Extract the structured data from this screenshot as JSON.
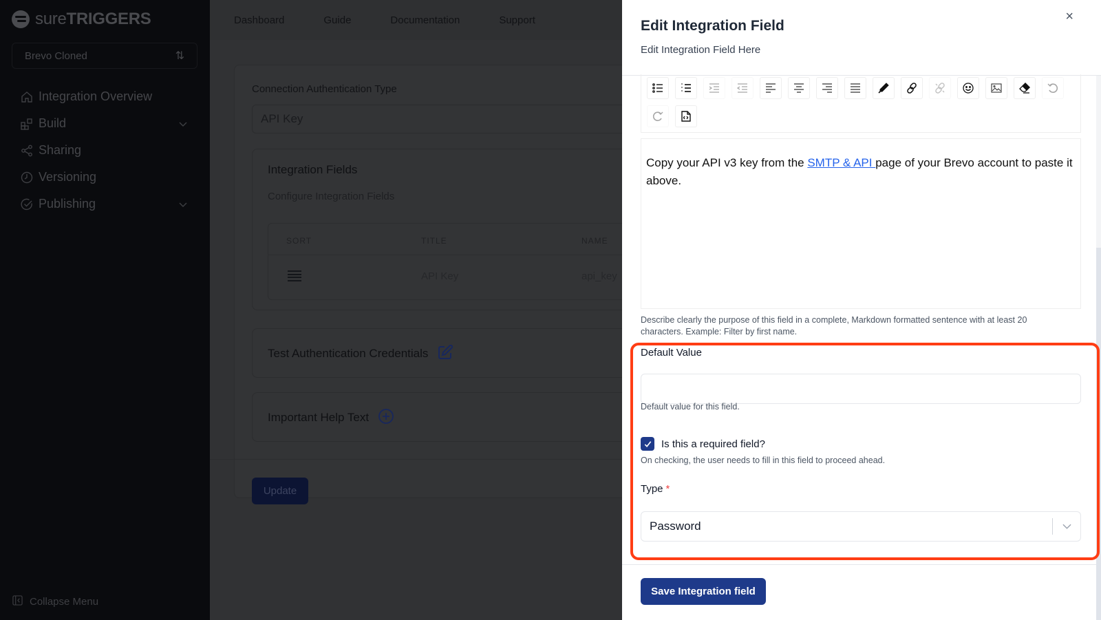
{
  "sidebar": {
    "logo": {
      "light": "sure",
      "bold": "TRIGGERS"
    },
    "project": "Brevo Cloned",
    "items": [
      {
        "label": "Integration Overview",
        "icon": "home-icon",
        "has_chevron": false
      },
      {
        "label": "Build",
        "icon": "blocks-icon",
        "has_chevron": true
      },
      {
        "label": "Sharing",
        "icon": "share-icon",
        "has_chevron": false
      },
      {
        "label": "Versioning",
        "icon": "clock-icon",
        "has_chevron": false
      },
      {
        "label": "Publishing",
        "icon": "check-circle-icon",
        "has_chevron": true
      }
    ],
    "collapse_label": "Collapse Menu"
  },
  "topnav": {
    "items": [
      "Dashboard",
      "Guide",
      "Documentation",
      "Support"
    ]
  },
  "main": {
    "auth_type_label": "Connection Authentication Type",
    "auth_type_value": "API Key",
    "fields_card": {
      "title": "Integration Fields",
      "description": "Configure Integration Fields",
      "columns": [
        "SORT",
        "TITLE",
        "NAME"
      ],
      "rows": [
        {
          "title": "API Key",
          "name": "api_key"
        }
      ]
    },
    "test_auth_title": "Test Authentication Credentials",
    "help_text_title": "Important Help Text",
    "update_label": "Update"
  },
  "drawer": {
    "title": "Edit Integration Field",
    "subtitle": "Edit Integration Field Here",
    "close_icon": "×",
    "toolbar": {
      "row1": [
        {
          "name": "bullet-list",
          "disabled": false
        },
        {
          "name": "numbered-list",
          "disabled": false
        },
        {
          "name": "indent",
          "disabled": true
        },
        {
          "name": "outdent",
          "disabled": true
        },
        {
          "name": "align-left",
          "disabled": false
        },
        {
          "name": "align-center",
          "disabled": false
        },
        {
          "name": "align-right",
          "disabled": false
        },
        {
          "name": "align-justify",
          "disabled": false
        },
        {
          "name": "text-color",
          "disabled": false
        },
        {
          "name": "link",
          "disabled": false
        },
        {
          "name": "unlink",
          "disabled": true
        },
        {
          "name": "emoji",
          "disabled": false
        },
        {
          "name": "image",
          "disabled": false
        },
        {
          "name": "remove-format",
          "disabled": false
        }
      ],
      "row2": [
        {
          "name": "undo",
          "disabled": true
        },
        {
          "name": "redo",
          "disabled": true
        },
        {
          "name": "source-code",
          "disabled": false
        }
      ]
    },
    "editor_content": {
      "before_link": "Copy your API v3 key from the ",
      "link_text": "SMTP & API ",
      "after_link": "page of your Brevo account to paste it above."
    },
    "editor_help": "Describe clearly the purpose of this field in a complete, Markdown formatted sentence with at least 20 characters. Example: Filter by first name.",
    "default_value": {
      "label": "Default Value",
      "value": "",
      "help": "Default value for this field."
    },
    "required": {
      "label": "Is this a required field?",
      "checked": true,
      "help": "On checking, the user needs to fill in this field to proceed ahead."
    },
    "type": {
      "label": "Type",
      "required_mark": "*",
      "value": "Password"
    },
    "save_label": "Save Integration field",
    "highlight_color": "#ff3d14",
    "accent_color": "#1e3a8a"
  }
}
